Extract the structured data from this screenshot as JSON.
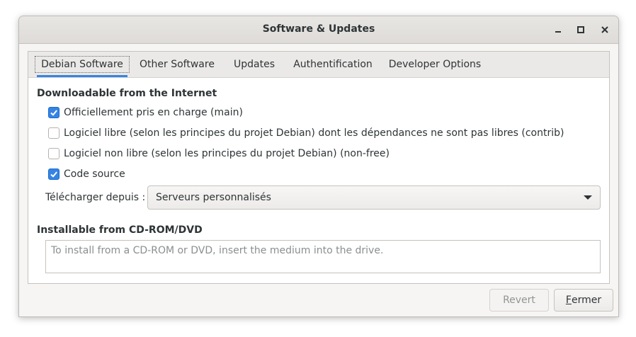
{
  "window": {
    "title": "Software & Updates"
  },
  "tabs": [
    {
      "label": "Debian Software",
      "active": true
    },
    {
      "label": "Other Software",
      "active": false
    },
    {
      "label": "Updates",
      "active": false
    },
    {
      "label": "Authentification",
      "active": false
    },
    {
      "label": "Developer Options",
      "active": false
    }
  ],
  "internet": {
    "heading": "Downloadable from the Internet",
    "options": [
      {
        "label": "Officiellement pris en charge (main)",
        "checked": true
      },
      {
        "label": "Logiciel libre (selon les principes du projet Debian) dont les dépendances ne sont pas libres (contrib)",
        "checked": false
      },
      {
        "label": "Logiciel non libre (selon les principes du projet Debian) (non-free)",
        "checked": false
      },
      {
        "label": "Code source",
        "checked": true
      }
    ],
    "download_from_label": "Télécharger depuis :",
    "download_from_value": "Serveurs personnalisés"
  },
  "cdrom": {
    "heading": "Installable from CD-ROM/DVD",
    "placeholder": "To install from a CD-ROM or DVD, insert the medium into the drive."
  },
  "buttons": {
    "revert": "Revert",
    "close_mnemonic": "F",
    "close_rest": "ermer"
  },
  "colors": {
    "accent": "#3584e4"
  }
}
